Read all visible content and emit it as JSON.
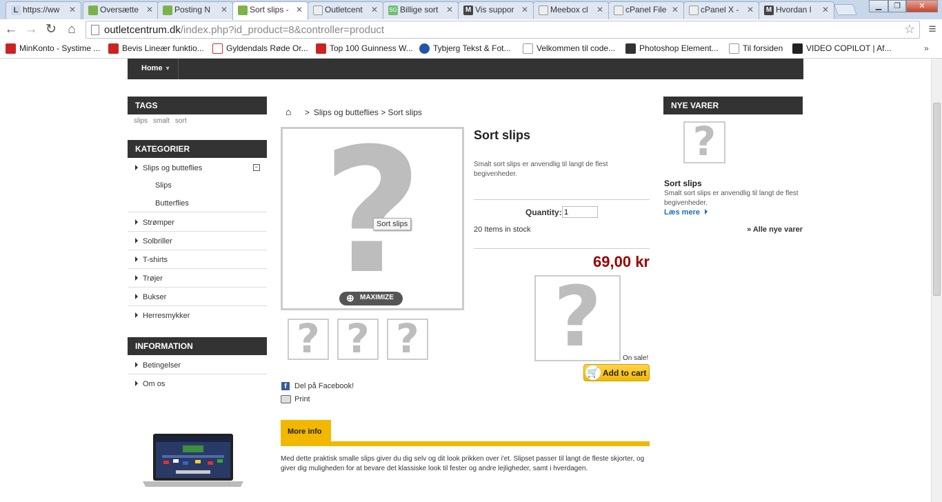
{
  "browser": {
    "tabs": [
      {
        "label": "https://ww",
        "color": "#cfd9e6",
        "glyph": "L"
      },
      {
        "label": "Oversætte",
        "color": "#7bb34a",
        "glyph": ""
      },
      {
        "label": "Posting N",
        "color": "#7bb34a",
        "glyph": ""
      },
      {
        "label": "Sort slips -",
        "color": "#7bb34a",
        "glyph": ""
      },
      {
        "label": "Outletcent",
        "color": "#e9e9e9",
        "glyph": ""
      },
      {
        "label": "Billige sort",
        "color": "#6fbf72",
        "glyph": "SG"
      },
      {
        "label": "Vis suppor",
        "color": "#444444",
        "glyph": "M"
      },
      {
        "label": "Meebox cl",
        "color": "#e9e9e9",
        "glyph": ""
      },
      {
        "label": "cPanel File",
        "color": "#e9e9e9",
        "glyph": ""
      },
      {
        "label": "cPanel X -",
        "color": "#e9e9e9",
        "glyph": ""
      },
      {
        "label": "Hvordan l",
        "color": "#444444",
        "glyph": "M"
      }
    ],
    "active_tab": 3,
    "url_host": "outletcentrum.dk",
    "url_path": "/index.php?id_product=8&controller=product",
    "bookmarks": [
      {
        "label": "MinKonto - Systime ...",
        "color": "#cc2222"
      },
      {
        "label": "Bevis Lineær funktio...",
        "color": "#cc2222"
      },
      {
        "label": "Gyldendals Røde Or...",
        "color": "#cc2222"
      },
      {
        "label": "Top 100 Guinness W...",
        "color": "#cc2222"
      },
      {
        "label": "Tybjerg Tekst & Fot...",
        "color": "#2255aa"
      },
      {
        "label": "Velkommen til code...",
        "color": "#ffffff"
      },
      {
        "label": "Photoshop Element...",
        "color": "#333333"
      },
      {
        "label": "Til forsiden",
        "color": "#ffffff"
      },
      {
        "label": "VIDEO COPILOT | Af...",
        "color": "#222222"
      }
    ]
  },
  "menu": {
    "home": "Home"
  },
  "tags_block": {
    "title": "TAGS",
    "tags": [
      "slips",
      "smalt",
      "sort"
    ]
  },
  "categories_block": {
    "title": "KATEGORIER",
    "items": [
      "Slips og butteflies",
      "Strømper",
      "Solbriller",
      "T-shirts",
      "Trøjer",
      "Bukser",
      "Herresmykker"
    ],
    "subitems": [
      "Slips",
      "Butterflies"
    ]
  },
  "information_block": {
    "title": "INFORMATION",
    "items": [
      "Betingelser",
      "Om os"
    ]
  },
  "breadcrumb": {
    "separator": ">",
    "path": "Slips og butteflies > Sort slips"
  },
  "product": {
    "name": "Sort slips",
    "short_description": "Smalt sort slips er anvendlig til langt de flest begivenheder.",
    "image_tooltip": "Sort slips",
    "maximize": "MAXIMIZE",
    "quantity_label": "Quantity:",
    "quantity_value": "1",
    "stock": "20 Items in stock",
    "price": "69,00 kr",
    "on_sale": "On sale!",
    "add_to_cart": "Add to cart",
    "share_facebook": "Del på Facebook!",
    "print": "Print",
    "more_info_tab": "More info",
    "long_description": "Med dette praktisk smalle slips giver du dig selv og dit look prikken over i'et. Slipset passer til langt de fleste skjorter, og giver dig muligheden for at bevare det klassiske look til fester og andre lejligheder, samt i hverdagen."
  },
  "new_products_block": {
    "title": "NYE VARER",
    "item_name": "Sort slips",
    "item_desc": "Smalt sort slips er anvendlig til langt de flest begivenheder.",
    "read_more": "Læs mere",
    "all_new": "» Alle nye varer"
  },
  "colors": {
    "price": "#990000",
    "accent_yellow": "#f2b800",
    "dark_bar": "#333333",
    "link_blue": "#1a6fb5"
  }
}
